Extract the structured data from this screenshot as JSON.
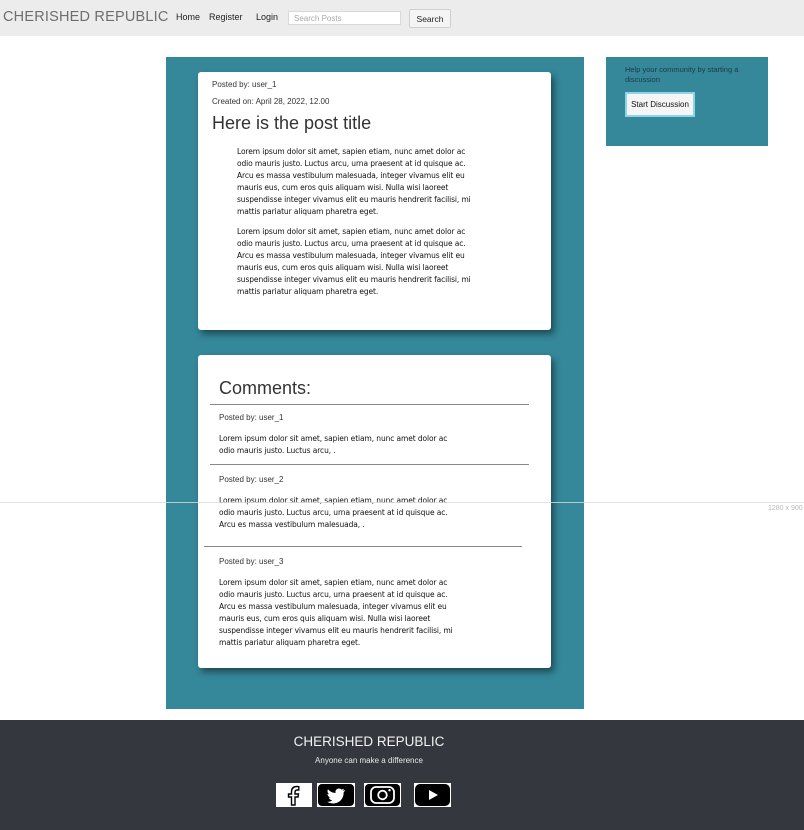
{
  "nav": {
    "brand": "CHERISHED REPUBLIC",
    "links": [
      "Home",
      "Register",
      "Login"
    ],
    "search_placeholder": "Search Posts",
    "search_button": "Search"
  },
  "post": {
    "posted_by": "Posted by: user_1",
    "created_on": "Created on: April 28, 2022, 12.00",
    "title": "Here is the post title",
    "paragraphs": [
      "Lorem ipsum dolor sit amet, sapien etiam, nunc amet dolor ac odio mauris justo. Luctus arcu, urna praesent at id quisque ac. Arcu es massa vestibulum malesuada, integer vivamus elit eu mauris eus, cum eros quis aliquam wisi. Nulla wisi laoreet suspendisse integer vivamus elit eu mauris hendrerit facilisi, mi mattis pariatur aliquam pharetra eget.",
      "Lorem ipsum dolor sit amet, sapien etiam, nunc amet dolor ac odio mauris justo. Luctus arcu, urna praesent at id quisque ac. Arcu es massa vestibulum malesuada, integer vivamus elit eu mauris eus, cum eros quis aliquam wisi. Nulla wisi laoreet suspendisse integer vivamus elit eu mauris hendrerit facilisi, mi mattis pariatur aliquam pharetra eget."
    ]
  },
  "comments": {
    "heading": "Comments:",
    "items": [
      {
        "posted_by": "Posted by: user_1",
        "text": "Lorem ipsum dolor sit amet, sapien etiam, nunc amet dolor ac odio mauris justo. Luctus arcu, ."
      },
      {
        "posted_by": "Posted by: user_2",
        "text": "Lorem ipsum dolor sit amet, sapien etiam, nunc amet dolor ac odio mauris justo. Luctus arcu, urna praesent at id quisque ac. Arcu es massa vestibulum malesuada, ."
      },
      {
        "posted_by": "Posted by: user_3",
        "text": "Lorem ipsum dolor sit amet, sapien etiam, nunc amet dolor ac odio mauris justo. Luctus arcu, urna praesent at id quisque ac. Arcu es massa vestibulum malesuada, integer vivamus elit eu mauris eus, cum eros quis aliquam wisi. Nulla wisi laoreet suspendisse integer vivamus elit eu mauris hendrerit facilisi, mi mattis pariatur aliquam pharetra eget."
      }
    ]
  },
  "sidebar": {
    "text": "Help your community by starting a discussion",
    "button": "Start Discussion"
  },
  "viewport_label": "1280 x 900",
  "footer": {
    "title": "CHERISHED REPUBLIC",
    "tagline": "Anyone can make a difference",
    "social_icons": [
      "facebook-icon",
      "twitter-icon",
      "instagram-icon",
      "youtube-icon"
    ]
  },
  "colors": {
    "panel": "#35879a",
    "navbar": "#ececec",
    "footer": "#34373d"
  }
}
